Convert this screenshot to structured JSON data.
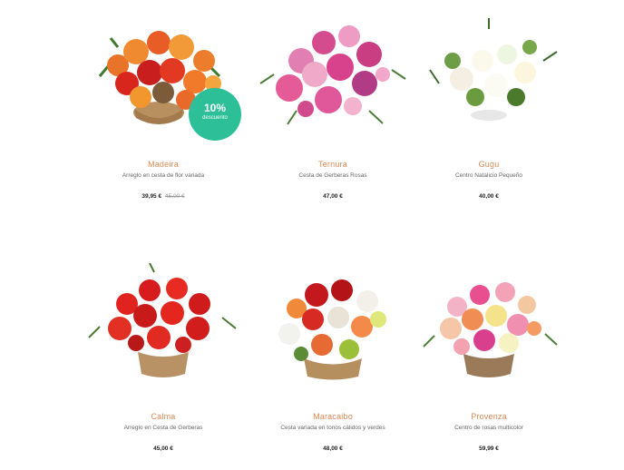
{
  "products": [
    {
      "name": "Madeira",
      "desc": "Arreglo en cesta de flor variada",
      "price": "39,95 €",
      "old_price": "45,00 €",
      "badge": {
        "pct": "10%",
        "label": "descuento"
      }
    },
    {
      "name": "Ternura",
      "desc": "Cesta de Gerberas Rosas",
      "price": "47,00 €"
    },
    {
      "name": "Gugu",
      "desc": "Centro Natalicio Pequeño",
      "price": "40,00 €"
    },
    {
      "name": "Calma",
      "desc": "Arreglo en Cesta de Gerberas",
      "price": "45,00 €"
    },
    {
      "name": "Maracaibo",
      "desc": "Cesta variada en tonos cálidos y verdes",
      "price": "48,00 €"
    },
    {
      "name": "Provenza",
      "desc": "Centro de rosas multicolor",
      "price": "59,99 €"
    }
  ],
  "colors": {
    "name_color": "#d98a55",
    "badge_color": "#2cbf98",
    "image_icons": [
      "orange-red-bouquet-image",
      "pink-gerbera-bouquet-image",
      "white-christmas-centerpiece-image",
      "red-gerbera-basket-image",
      "mixed-warm-basket-image",
      "multicolor-roses-basket-image"
    ]
  }
}
